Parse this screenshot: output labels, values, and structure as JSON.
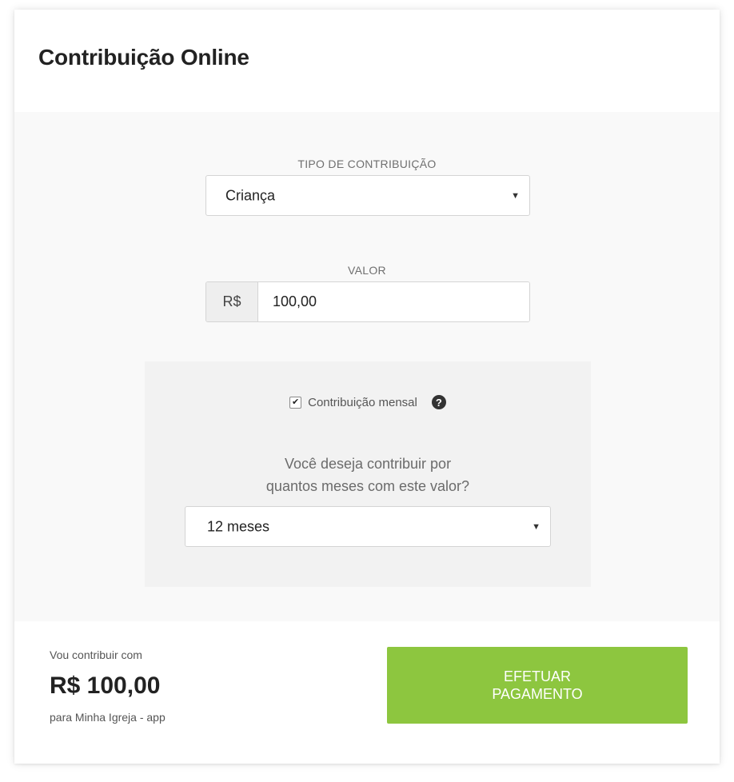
{
  "header": {
    "title": "Contribuição Online"
  },
  "form": {
    "type_label": "TIPO DE CONTRIBUIÇÃO",
    "type_value": "Criança",
    "amount_label": "VALOR",
    "currency_prefix": "R$",
    "amount_value": "100,00",
    "monthly": {
      "checked": true,
      "checkbox_label": "Contribuição mensal",
      "help_icon": "question-circle-icon",
      "question_line1": "Você deseja contribuir por",
      "question_line2": "quantos meses com este valor?",
      "months_value": "12 meses"
    }
  },
  "footer": {
    "intro": "Vou contribuir com",
    "total": "R$ 100,00",
    "recipient": "para Minha Igreja - app",
    "button_line1": "EFETUAR",
    "button_line2": "PAGAMENTO",
    "button_color": "#8dc63f"
  }
}
